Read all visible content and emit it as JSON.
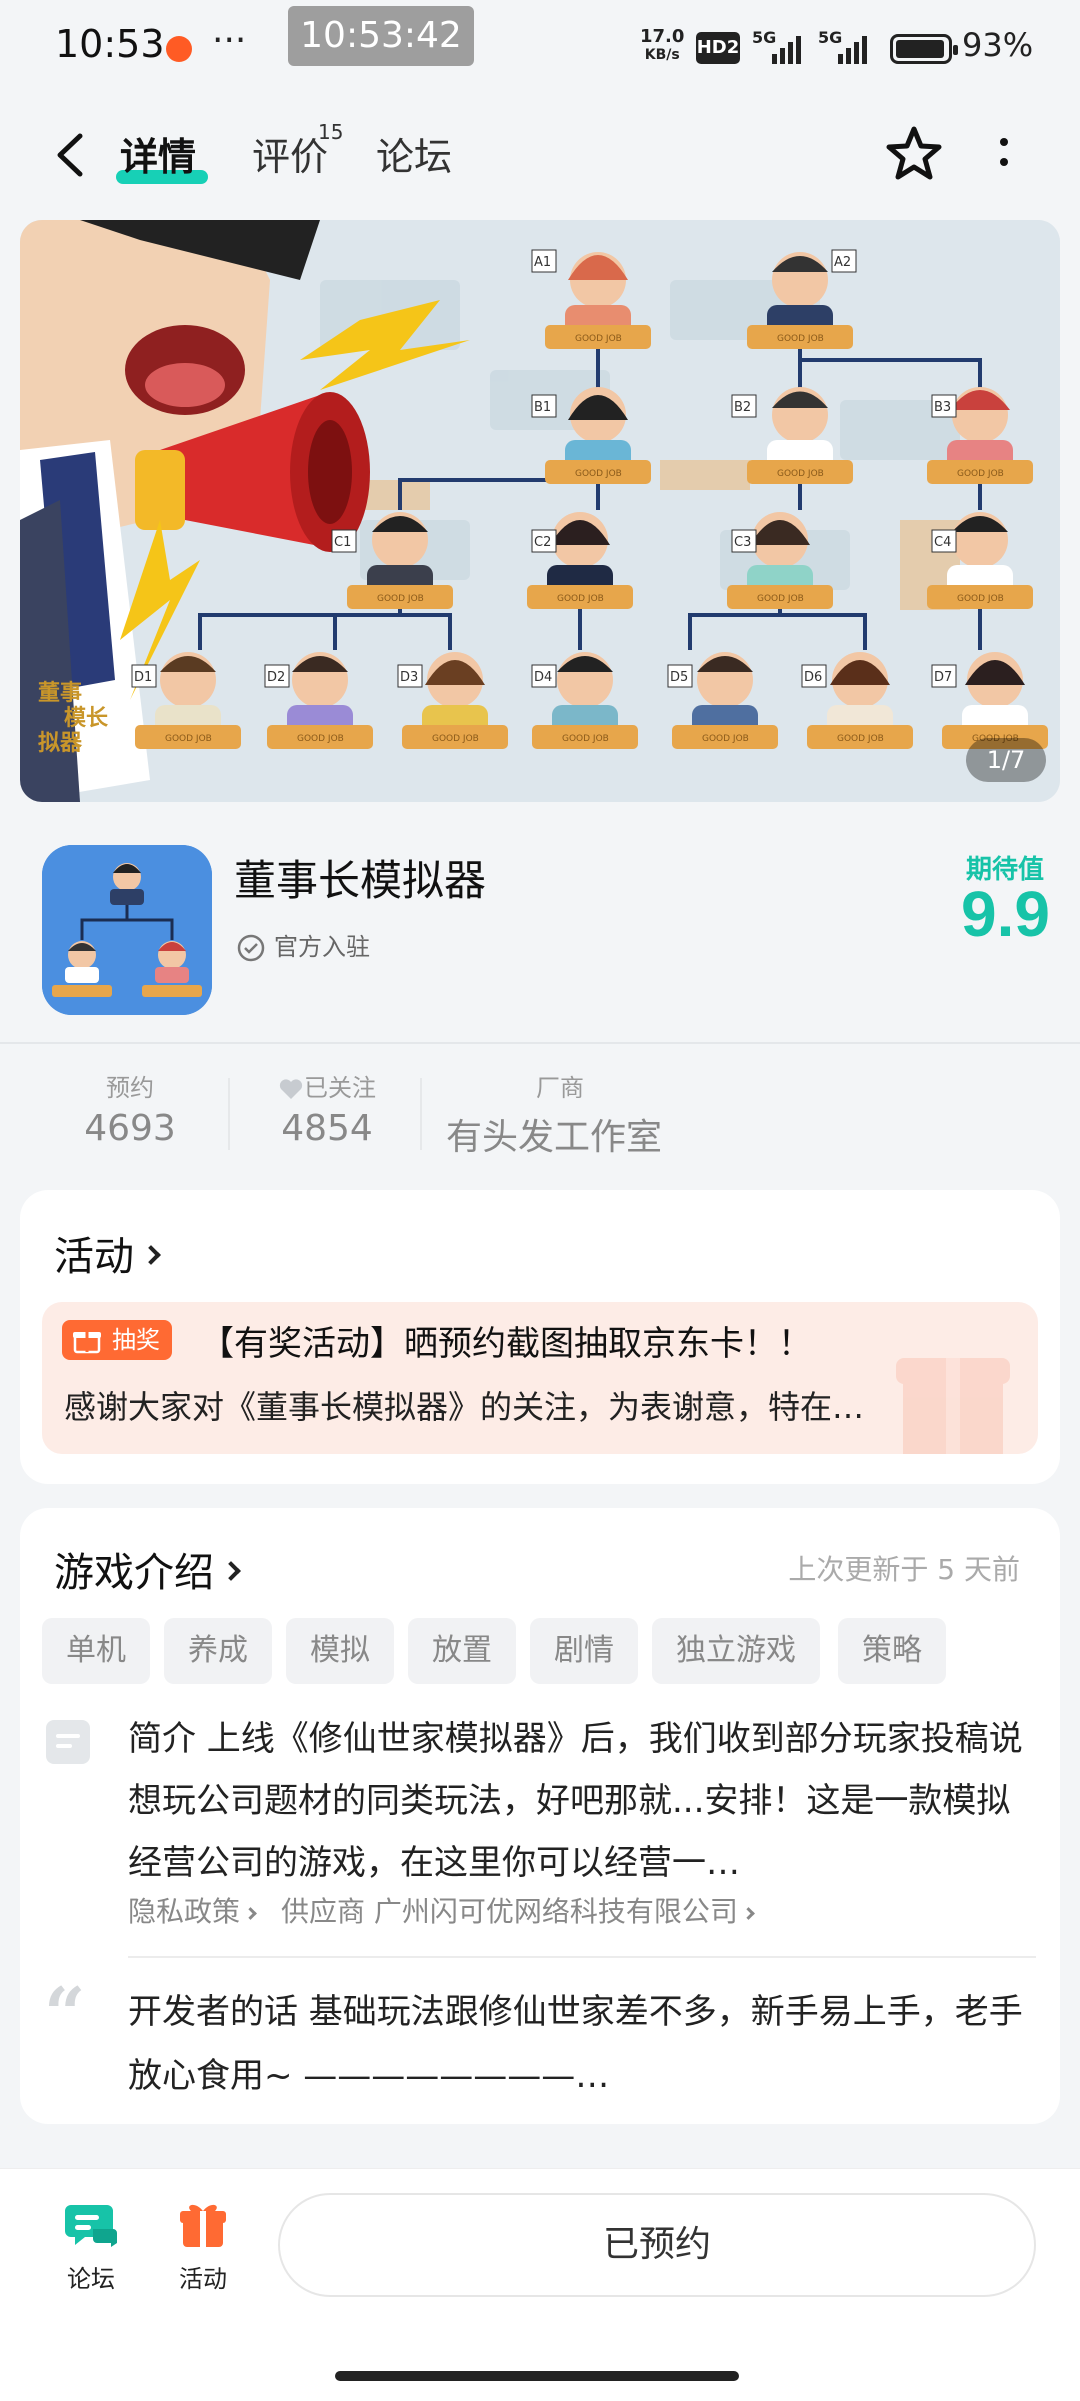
{
  "status_bar": {
    "time": "10:53",
    "more": "···",
    "floating_time": "10:53:42",
    "net_speed_value": "17.0",
    "net_speed_unit": "KB/s",
    "hd_badge": "HD2",
    "signal_1": "5G",
    "signal_2": "5G",
    "battery_level": 93,
    "battery_text": "93%"
  },
  "nav": {
    "tabs": [
      {
        "label": "详情",
        "active": true
      },
      {
        "label": "评价",
        "count": "15"
      },
      {
        "label": "论坛"
      }
    ],
    "icons": [
      "back-icon",
      "star-icon",
      "more-vertical-icon"
    ]
  },
  "banner": {
    "page_indicator": "1/7",
    "badge_labels": [
      "A1",
      "A2",
      "B1",
      "B2",
      "B3",
      "C1",
      "C2",
      "C3",
      "C4",
      "D1",
      "D2",
      "D3",
      "D4",
      "D5",
      "D6",
      "D7"
    ],
    "nameplate_text": "GOOD JOB",
    "side_calligraphy": "董事模长拟器"
  },
  "app": {
    "name": "董事长模拟器",
    "official_label": "官方入驻",
    "expect_label": "期待值",
    "expect_value": "9.9"
  },
  "stats": [
    {
      "label": "预约",
      "value": "4693"
    },
    {
      "label": "已关注",
      "value": "4854"
    },
    {
      "label": "厂商",
      "value": "有头发工作室"
    }
  ],
  "activity": {
    "title": "活动",
    "badge": "抽奖",
    "headline": "【有奖活动】晒预约截图抽取京东卡！！",
    "desc": "感谢大家对《董事长模拟器》的关注，为表谢意，特在…"
  },
  "intro": {
    "title": "游戏介绍",
    "updated": "上次更新于 5 天前",
    "tags": [
      "单机",
      "养成",
      "模拟",
      "放置",
      "剧情",
      "独立游戏",
      "策略"
    ],
    "summary": "简介 上线《修仙世家模拟器》后，我们收到部分玩家投稿说想玩公司题材的同类玩法，好吧那就...安排！这是一款模拟经营公司的游戏，在这里你可以经营一…",
    "privacy_link": "隐私政策",
    "supplier_link": "供应商 广州闪可优网络科技有限公司",
    "dev_words": "开发者的话 基础玩法跟修仙世家差不多，新手易上手，老手放心食用~ ————————…"
  },
  "bottom": {
    "forum_label": "论坛",
    "activity_label": "活动",
    "reserved_label": "已预约"
  },
  "colors": {
    "accent": "#17c3a8",
    "orange": "#ff6a33",
    "background": "#f3f5f7"
  }
}
